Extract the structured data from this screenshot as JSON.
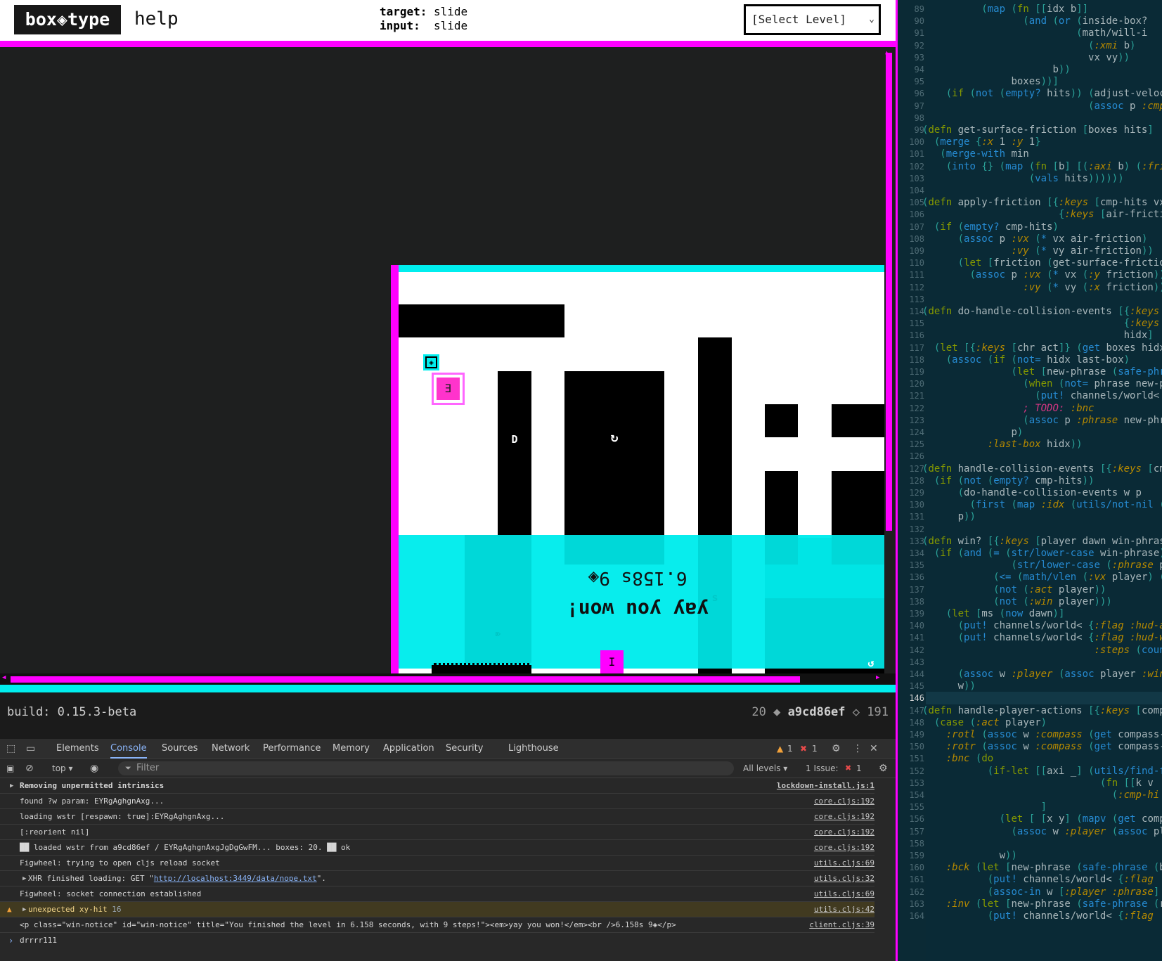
{
  "header": {
    "logo": "box◈type",
    "help": "help",
    "target_label": "target:",
    "target_value": "slide",
    "input_label": "input:",
    "input_value": "slide",
    "level_select": "[Select Level]"
  },
  "level": {
    "glyphs": {
      "d": "D",
      "undo": "↻",
      "e": "E",
      "i": "I",
      "s": "s",
      "eye": "⌦",
      "swirl": "↺"
    },
    "win_time": "6.158s 9◈",
    "win_msg": "yay you won!"
  },
  "footer": {
    "build": "build: 0.15.3-beta",
    "count": "20",
    "sep": "◆",
    "hash": "a9cd86ef",
    "sep2": "◇",
    "steps": "191"
  },
  "devtools": {
    "tabs": [
      "Elements",
      "Console",
      "Sources",
      "Network",
      "Performance",
      "Memory",
      "Application",
      "Security",
      "Lighthouse"
    ],
    "active_tab": "Console",
    "warn_count": "1",
    "err_count": "1",
    "context": "top",
    "filter_placeholder": "Filter",
    "levels": "All levels",
    "issues_label": "1 Issue:",
    "issues_count": "1",
    "log": [
      {
        "text": "Removing unpermitted intrinsics",
        "src": "lockdown-install.js:1"
      },
      {
        "text": "found ?w param: EYRgAghgnAxg...",
        "src": "core.cljs:192"
      },
      {
        "text": "loading wstr [respawn: true]:EYRgAghgnAxg...",
        "src": "core.cljs:192"
      },
      {
        "text": "[:reorient nil]",
        "src": "core.cljs:192"
      },
      {
        "text": "██ loaded wstr from a9cd86ef / EYRgAghgnAxgJgDgGwFM... boxes: 20. ██ ok",
        "src": "core.cljs:192"
      },
      {
        "text": "Figwheel: trying to open cljs reload socket",
        "src": "utils.cljs:69"
      },
      {
        "text_pre": "XHR finished loading: GET \"",
        "link": "http://localhost:3449/data/nope.txt",
        "text_post": "\".",
        "src": "utils.cljs:32"
      },
      {
        "text": "Figwheel: socket connection established",
        "src": "utils.cljs:69"
      },
      {
        "text": "unexpected xy-hit",
        "count": "16",
        "src": "utils.cljs:42"
      },
      {
        "text": "<p class=\"win-notice\" id=\"win-notice\" title=\"You finished the level in 6.158 seconds, with 9 steps!\"><em>yay you won!</em><br />6.158s 9◈</p>",
        "src": "client.cljs:39"
      }
    ],
    "prompt": "drrrr111"
  },
  "editor": {
    "lines": [
      {
        "n": "89",
        "t": "          (map (fn [[idx b]]"
      },
      {
        "n": "90",
        "t": "                 (and (or (inside-box?"
      },
      {
        "n": "91",
        "t": "                          (math/will-i"
      },
      {
        "n": "92",
        "t": "                            (:xmi b)"
      },
      {
        "n": "93",
        "t": "                            vx vy))"
      },
      {
        "n": "94",
        "t": "                      b))"
      },
      {
        "n": "95",
        "t": "               boxes))]"
      },
      {
        "n": "96",
        "t": "    (if (not (empty? hits)) (adjust-velocit"
      },
      {
        "n": "97",
        "t": "                            (assoc p :cmp-h"
      },
      {
        "n": "98",
        "t": ""
      },
      {
        "n": "99",
        "t": "(defn get-surface-friction [boxes hits]"
      },
      {
        "n": "100",
        "t": "  (merge {:x 1 :y 1}"
      },
      {
        "n": "101",
        "t": "   (merge-with min"
      },
      {
        "n": "102",
        "t": "    (into {} (map (fn [b] [(:axi b) (:frict"
      },
      {
        "n": "103",
        "t": "                  (vals hits))))))"
      },
      {
        "n": "104",
        "t": ""
      },
      {
        "n": "105",
        "t": "(defn apply-friction [{:keys [cmp-hits vx v"
      },
      {
        "n": "106",
        "t": "                       {:keys [air-friction"
      },
      {
        "n": "107",
        "t": "  (if (empty? cmp-hits)"
      },
      {
        "n": "108",
        "t": "      (assoc p :vx (* vx air-friction)"
      },
      {
        "n": "109",
        "t": "               :vy (* vy air-friction))"
      },
      {
        "n": "110",
        "t": "      (let [friction (get-surface-friction"
      },
      {
        "n": "111",
        "t": "        (assoc p :vx (* vx (:y friction))"
      },
      {
        "n": "112",
        "t": "                 :vy (* vy (:x friction))))"
      },
      {
        "n": "113",
        "t": ""
      },
      {
        "n": "114",
        "t": "(defn do-handle-collision-events [{:keys [b"
      },
      {
        "n": "115",
        "t": "                                  {:keys []"
      },
      {
        "n": "116",
        "t": "                                  hidx]"
      },
      {
        "n": "117",
        "t": "  (let [{:keys [chr act]} (get boxes hidx)]"
      },
      {
        "n": "118",
        "t": "    (assoc (if (not= hidx last-box)"
      },
      {
        "n": "119",
        "t": "               (let [new-phrase (safe-phras"
      },
      {
        "n": "120",
        "t": "                 (when (not= phrase new-phr"
      },
      {
        "n": "121",
        "t": "                   (put! channels/world< {"
      },
      {
        "n": "122",
        "t": "                 ; TODO: :bnc"
      },
      {
        "n": "123",
        "t": "                 (assoc p :phrase new-phras"
      },
      {
        "n": "124",
        "t": "               p)"
      },
      {
        "n": "125",
        "t": "           :last-box hidx))"
      },
      {
        "n": "126",
        "t": ""
      },
      {
        "n": "127",
        "t": "(defn handle-collision-events [{:keys [cmp-"
      },
      {
        "n": "128",
        "t": "  (if (not (empty? cmp-hits))"
      },
      {
        "n": "129",
        "t": "      (do-handle-collision-events w p"
      },
      {
        "n": "130",
        "t": "        (first (map :idx (utils/not-nil (ma"
      },
      {
        "n": "131",
        "t": "      p))"
      },
      {
        "n": "132",
        "t": ""
      },
      {
        "n": "133",
        "t": "(defn win? [{:keys [player dawn win-phrase]"
      },
      {
        "n": "134",
        "t": "  (if (and (= (str/lower-case win-phrase)"
      },
      {
        "n": "135",
        "t": "               (str/lower-case (:phrase play"
      },
      {
        "n": "136",
        "t": "            (<= (math/vlen (:vx player) (:vy"
      },
      {
        "n": "137",
        "t": "            (not (:act player))"
      },
      {
        "n": "138",
        "t": "            (not (:win player)))"
      },
      {
        "n": "139",
        "t": "    (let [ms (now dawn)]"
      },
      {
        "n": "140",
        "t": "      (put! channels/world< {:flag :hud-ava"
      },
      {
        "n": "141",
        "t": "      (put! channels/world< {:flag :hud-win"
      },
      {
        "n": "142",
        "t": "                             :steps (count"
      },
      {
        "n": "143",
        "t": ""
      },
      {
        "n": "144",
        "t": "      (assoc w :player (assoc player :win m"
      },
      {
        "n": "145",
        "t": "      w))"
      },
      {
        "n": "146",
        "t": ""
      },
      {
        "n": "147",
        "t": "(defn handle-player-actions [{:keys [compas"
      },
      {
        "n": "148",
        "t": "  (case (:act player)"
      },
      {
        "n": "149",
        "t": "    :rotl (assoc w :compass (get compass-"
      },
      {
        "n": "150",
        "t": "    :rotr (assoc w :compass (get compass-"
      },
      {
        "n": "151",
        "t": "    :bnc (do"
      },
      {
        "n": "152",
        "t": "           (if-let [[axi _] (utils/find-f"
      },
      {
        "n": "153",
        "t": "                              (fn [[k v"
      },
      {
        "n": "154",
        "t": "                                (:cmp-hi"
      },
      {
        "n": "155",
        "t": "                    ]"
      },
      {
        "n": "156",
        "t": "             (let [ [x y] (mapv (get comp"
      },
      {
        "n": "157",
        "t": "               (assoc w :player (assoc pl"
      },
      {
        "n": "158",
        "t": ""
      },
      {
        "n": "159",
        "t": "             w))"
      },
      {
        "n": "160",
        "t": "    :bck (let [new-phrase (safe-phrase (b"
      },
      {
        "n": "161",
        "t": "           (put! channels/world< {:flag"
      },
      {
        "n": "162",
        "t": "           (assoc-in w [:player :phrase]"
      },
      {
        "n": "163",
        "t": "    :inv (let [new-phrase (safe-phrase (r"
      },
      {
        "n": "164",
        "t": "           (put! channels/world< {:flag"
      }
    ],
    "current_line": "146"
  }
}
